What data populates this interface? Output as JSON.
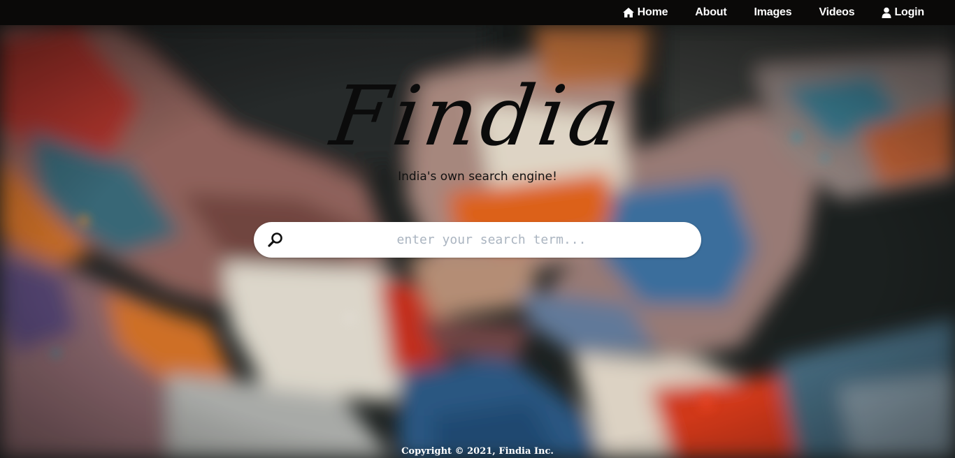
{
  "nav": {
    "items": [
      {
        "label": "Home",
        "icon": "home-icon"
      },
      {
        "label": "About"
      },
      {
        "label": "Images"
      },
      {
        "label": "Videos"
      },
      {
        "label": "Login",
        "icon": "user-icon"
      }
    ]
  },
  "hero": {
    "logo_text": "Findia",
    "tagline": "India's own search engine!"
  },
  "search": {
    "placeholder": "enter your search term...",
    "value": "",
    "icon": "search-icon"
  },
  "footer": {
    "copyright": "Copyright © 2021, Findia Inc."
  },
  "colors": {
    "topbar": "#0a0908",
    "nav_text": "#ffffff",
    "logo": "#0b0b0b",
    "placeholder": "#aab4c0"
  }
}
